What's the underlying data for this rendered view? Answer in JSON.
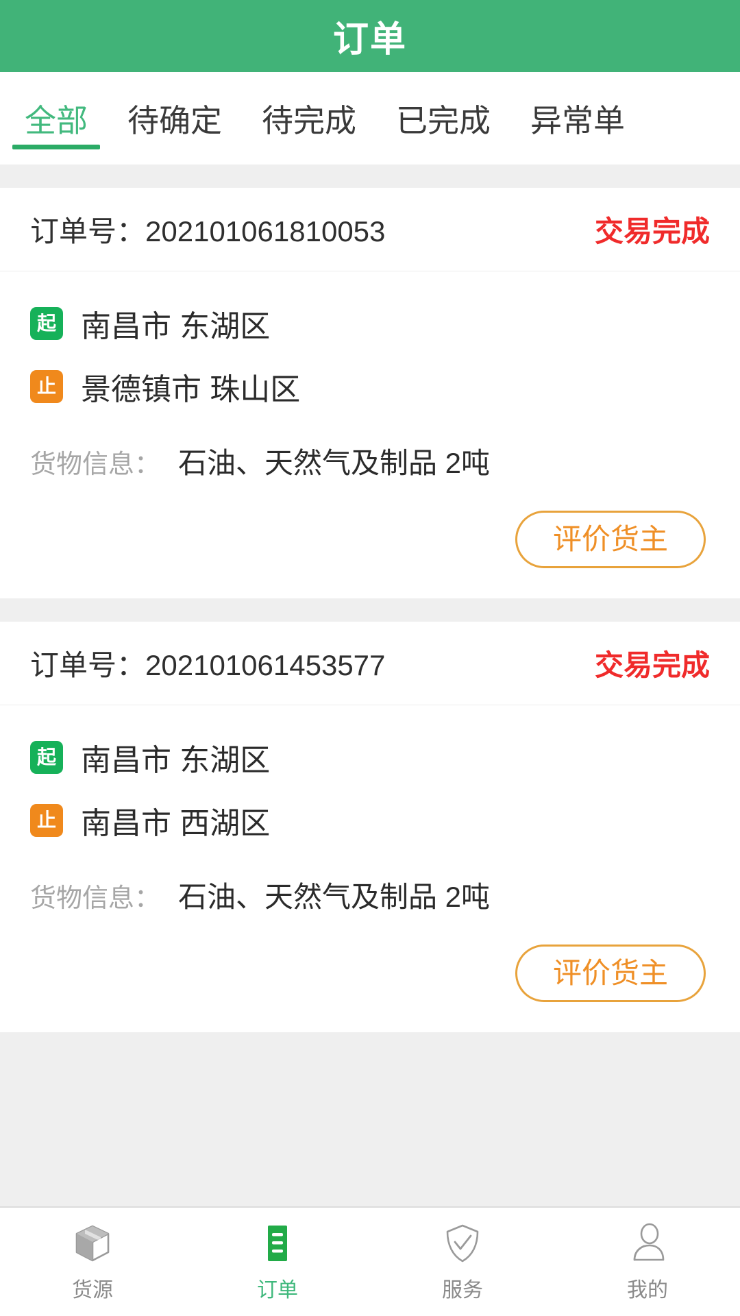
{
  "header": {
    "title": "订单"
  },
  "tabs": [
    {
      "label": "全部",
      "active": true
    },
    {
      "label": "待确定",
      "active": false
    },
    {
      "label": "待完成",
      "active": false
    },
    {
      "label": "已完成",
      "active": false
    },
    {
      "label": "异常单",
      "active": false
    }
  ],
  "colors": {
    "header_green": "#41b378",
    "active_tab_green": "#42b97e",
    "status_red": "#f02b2b",
    "badge_start_green": "#16b159",
    "badge_end_orange": "#f0891c",
    "button_orange": "#ef8f26"
  },
  "orders": [
    {
      "order_label": "订单号：",
      "order_number": "202101061810053",
      "status": "交易完成",
      "origin_badge": "起",
      "origin": "南昌市 东湖区",
      "destination_badge": "止",
      "destination": "景德镇市 珠山区",
      "cargo_label": "货物信息：",
      "cargo_value": "石油、天然气及制品 2吨",
      "action_label": "评价货主"
    },
    {
      "order_label": "订单号：",
      "order_number": "202101061453577",
      "status": "交易完成",
      "origin_badge": "起",
      "origin": "南昌市 东湖区",
      "destination_badge": "止",
      "destination": "南昌市 西湖区",
      "cargo_label": "货物信息：",
      "cargo_value": "石油、天然气及制品 2吨",
      "action_label": "评价货主"
    }
  ],
  "bottom_nav": [
    {
      "label": "货源",
      "icon": "box-icon",
      "active": false
    },
    {
      "label": "订单",
      "icon": "list-icon",
      "active": true
    },
    {
      "label": "服务",
      "icon": "shield-check-icon",
      "active": false
    },
    {
      "label": "我的",
      "icon": "person-icon",
      "active": false
    }
  ]
}
